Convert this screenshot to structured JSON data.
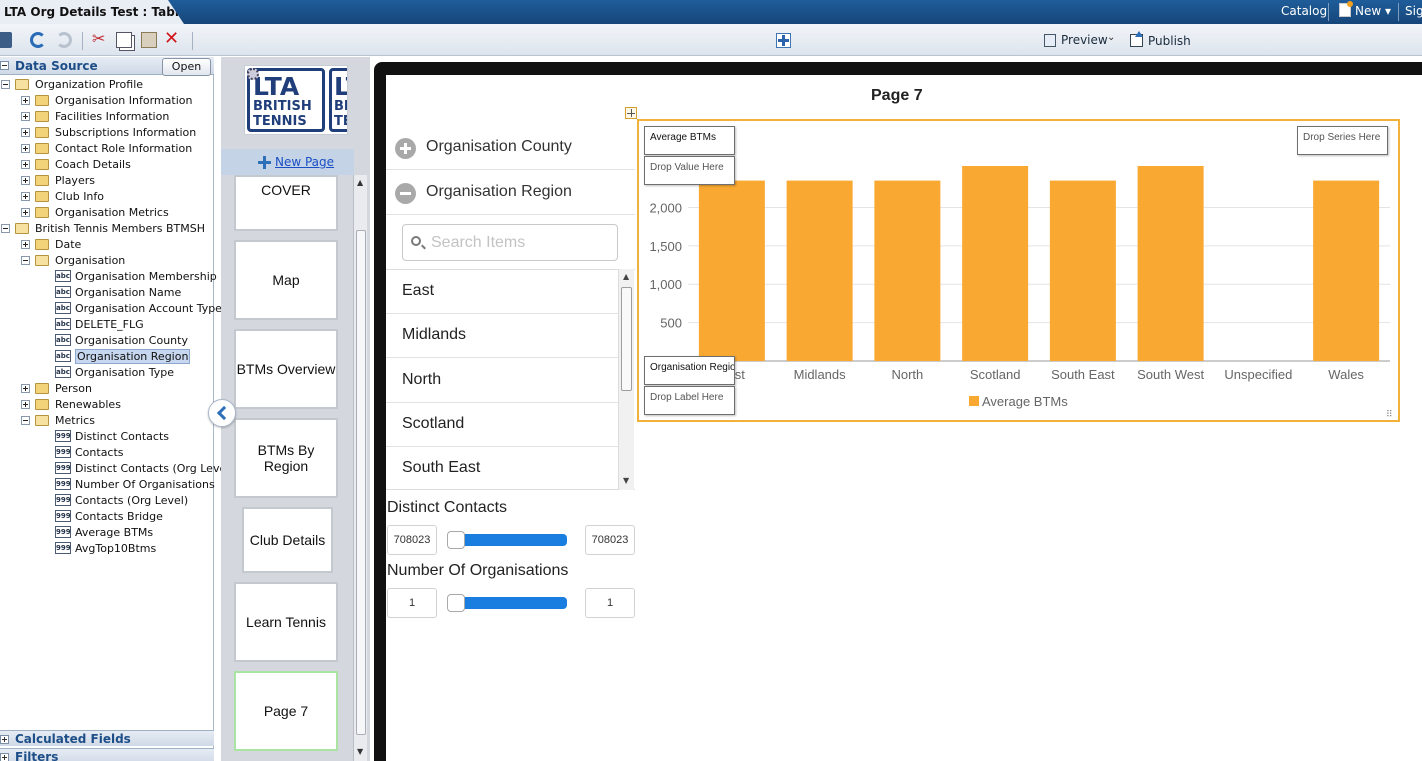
{
  "window": {
    "tab_title": "LTA Org Details Test : Tablet",
    "links": {
      "catalog": "Catalog",
      "new": "New",
      "sign": "Sign"
    }
  },
  "toolbar": {
    "preview_label": "Preview",
    "publish_label": "Publish"
  },
  "data_source": {
    "title": "Data Source",
    "open_label": "Open",
    "tree": [
      {
        "label": "Organization Profile",
        "kind": "folder",
        "expanded": true,
        "level": 0
      },
      {
        "label": "Organisation Information",
        "kind": "folder",
        "expanded": false,
        "level": 1
      },
      {
        "label": "Facilities Information",
        "kind": "folder",
        "expanded": false,
        "level": 1
      },
      {
        "label": "Subscriptions Information",
        "kind": "folder",
        "expanded": false,
        "level": 1
      },
      {
        "label": "Contact Role Information",
        "kind": "folder",
        "expanded": false,
        "level": 1
      },
      {
        "label": "Coach Details",
        "kind": "folder",
        "expanded": false,
        "level": 1
      },
      {
        "label": "Players",
        "kind": "folder",
        "expanded": false,
        "level": 1
      },
      {
        "label": "Club Info",
        "kind": "folder",
        "expanded": false,
        "level": 1
      },
      {
        "label": "Organisation Metrics",
        "kind": "folder",
        "expanded": false,
        "level": 1
      },
      {
        "label": "British Tennis Members BTMSH",
        "kind": "folder",
        "expanded": true,
        "level": 0
      },
      {
        "label": "Date",
        "kind": "folder",
        "expanded": false,
        "level": 1
      },
      {
        "label": "Organisation",
        "kind": "folder",
        "expanded": true,
        "level": 1
      },
      {
        "label": "Organisation Membership Nu",
        "kind": "abc",
        "level": 2
      },
      {
        "label": "Organisation Name",
        "kind": "abc",
        "level": 2
      },
      {
        "label": "Organisation Account Type",
        "kind": "abc",
        "level": 2
      },
      {
        "label": "DELETE_FLG",
        "kind": "abc",
        "level": 2
      },
      {
        "label": "Organisation County",
        "kind": "abc",
        "level": 2
      },
      {
        "label": "Organisation Region",
        "kind": "abc",
        "level": 2,
        "selected": true
      },
      {
        "label": "Organisation Type",
        "kind": "abc",
        "level": 2
      },
      {
        "label": "Person",
        "kind": "folder",
        "expanded": false,
        "level": 1
      },
      {
        "label": "Renewables",
        "kind": "folder",
        "expanded": false,
        "level": 1
      },
      {
        "label": "Metrics",
        "kind": "folder",
        "expanded": true,
        "level": 1
      },
      {
        "label": "Distinct Contacts",
        "kind": "num",
        "level": 2
      },
      {
        "label": "Contacts",
        "kind": "num",
        "level": 2
      },
      {
        "label": "Distinct Contacts (Org Level)",
        "kind": "num",
        "level": 2
      },
      {
        "label": "Number Of Organisations",
        "kind": "num",
        "level": 2
      },
      {
        "label": "Contacts (Org Level)",
        "kind": "num",
        "level": 2
      },
      {
        "label": "Contacts Bridge",
        "kind": "num",
        "level": 2
      },
      {
        "label": "Average BTMs",
        "kind": "num",
        "level": 2
      },
      {
        "label": "AvgTop10Btms",
        "kind": "num",
        "level": 2
      }
    ],
    "icon_labels": {
      "abc": "abc",
      "num": "999"
    },
    "footer": [
      "Calculated Fields",
      "Filters"
    ]
  },
  "pages": {
    "logo": {
      "line1": "LTA",
      "line2": "BRITISH",
      "line3": "TENNIS",
      "line1b": "LT",
      "line2b": "BI",
      "line3b": "TE"
    },
    "new_page_label": "New Page",
    "thumbnails": [
      {
        "label": "COVER"
      },
      {
        "label": "Map"
      },
      {
        "label": "BTMs Overview"
      },
      {
        "label": "BTMs By Region"
      },
      {
        "label": "Club Details"
      },
      {
        "label": "Learn Tennis"
      },
      {
        "label": "Page 7",
        "active": true
      }
    ]
  },
  "canvas": {
    "page_title": "Page 7",
    "filters": {
      "accordion": [
        {
          "label": "Organisation County",
          "state": "collapsed"
        },
        {
          "label": "Organisation Region",
          "state": "expanded"
        }
      ],
      "search_placeholder": "Search Items",
      "region_items": [
        "East",
        "Midlands",
        "North",
        "Scotland",
        "South East"
      ],
      "sliders": [
        {
          "title": "Distinct Contacts",
          "min": "708023",
          "max": "708023"
        },
        {
          "title": "Number Of Organisations",
          "min": "1",
          "max": "1"
        }
      ]
    },
    "chart_drop_zones": {
      "value_field": "Average BTMs",
      "value_hint": "Drop Value Here",
      "series_hint": "Drop Series Here",
      "label_field": "Organisation Region",
      "label_hint": "Drop Label Here"
    }
  },
  "chart_data": {
    "type": "bar",
    "categories": [
      "East",
      "Midlands",
      "North",
      "Scotland",
      "South East",
      "South West",
      "Unspecified",
      "Wales"
    ],
    "series": [
      {
        "name": "Average BTMs",
        "values": [
          2350,
          2350,
          2350,
          2540,
          2350,
          2540,
          0,
          2350
        ]
      }
    ],
    "ylim": [
      0,
      2540
    ],
    "yticks": [
      "500",
      "1,000",
      "1,500",
      "2,000"
    ],
    "ytick_values": [
      500,
      1000,
      1500,
      2000
    ],
    "grid": true,
    "legend": "bottom",
    "colors": {
      "bar": "#f9a932",
      "gridline": "#e4e4e4",
      "axis_text": "#666666"
    }
  }
}
